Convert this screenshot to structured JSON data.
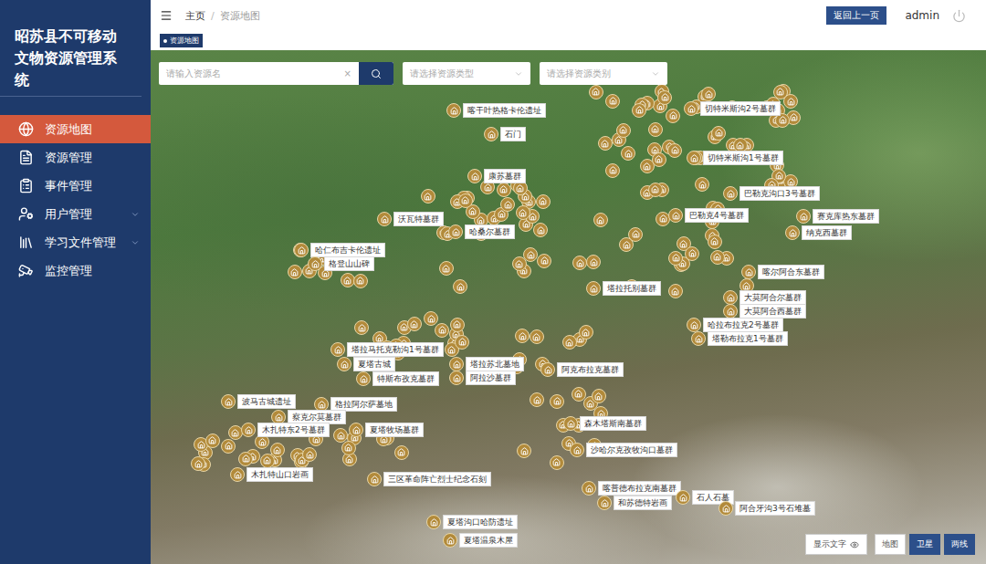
{
  "sidebar": {
    "title": "昭苏县不可移动文物资源管理系统",
    "items": [
      {
        "label": "资源地图",
        "selected": true,
        "expandable": false
      },
      {
        "label": "资源管理",
        "selected": false,
        "expandable": false
      },
      {
        "label": "事件管理",
        "selected": false,
        "expandable": false
      },
      {
        "label": "用户管理",
        "selected": false,
        "expandable": true
      },
      {
        "label": "学习文件管理",
        "selected": false,
        "expandable": true
      },
      {
        "label": "监控管理",
        "selected": false,
        "expandable": false
      }
    ]
  },
  "header": {
    "breadcrumb": [
      "主页",
      "资源地图"
    ],
    "separator": "/",
    "back_button": "返回上一页",
    "user": "admin"
  },
  "tags": [
    {
      "label": "资源地图",
      "selected": true
    }
  ],
  "search": {
    "placeholder": "请输入资源名",
    "clear": "×"
  },
  "filters": [
    {
      "placeholder": "请选择资源类型"
    },
    {
      "placeholder": "请选择资源类别"
    }
  ],
  "map": {
    "sites": [
      {
        "name": "喀干叶热格卡伦遗址"
      },
      {
        "name": "石门"
      },
      {
        "name": "切特米斯沟2号墓群"
      },
      {
        "name": "切特米斯沟1号墓群"
      },
      {
        "name": "康苏墓群"
      },
      {
        "name": "沃瓦特墓群"
      },
      {
        "name": "哈桑尔墓群"
      },
      {
        "name": "巴勒克沟口3号墓群"
      },
      {
        "name": "巴勒克4号墓群"
      },
      {
        "name": "赛克库热东墓群"
      },
      {
        "name": "纳克西墓群"
      },
      {
        "name": "哈仁布吉卡伦遗址"
      },
      {
        "name": "格登山山碑"
      },
      {
        "name": "喀尔阿合东墓群"
      },
      {
        "name": "塔拉托别墓群"
      },
      {
        "name": "大莫阿合尔墓群"
      },
      {
        "name": "大莫阿合西墓群"
      },
      {
        "name": "哈拉布拉克2号墓群"
      },
      {
        "name": "塔勒布拉克1号墓群"
      },
      {
        "name": "塔拉马托克勒沟1号墓群"
      },
      {
        "name": "夏塔古城"
      },
      {
        "name": "特斯布孜克墓群"
      },
      {
        "name": "塔拉苏北墓地"
      },
      {
        "name": "阿拉沙墓群"
      },
      {
        "name": "阿克布拉克墓群"
      },
      {
        "name": "波马古城遗址"
      },
      {
        "name": "格拉阿尔萨墓地"
      },
      {
        "name": "察克尔莫墓群"
      },
      {
        "name": "森木塔斯南墓群"
      },
      {
        "name": "夏塔牧场墓群"
      },
      {
        "name": "木扎特东2号墓群"
      },
      {
        "name": "沙哈尔克孜牧沟口墓群"
      },
      {
        "name": "木扎特山口岩画"
      },
      {
        "name": "三区革命阵亡烈士纪念石刻"
      },
      {
        "name": "喀普德布拉克南墓群"
      },
      {
        "name": "和苏德特岩画"
      },
      {
        "name": "石人石墓"
      },
      {
        "name": "阿合牙沟3号石堆墓"
      },
      {
        "name": "夏塔沟口哈防遗址"
      },
      {
        "name": "夏塔温泉木屋"
      }
    ]
  },
  "controls": {
    "show_text": "显示文字",
    "layers": [
      {
        "label": "地图",
        "selected": false
      },
      {
        "label": "卫星",
        "selected": true
      },
      {
        "label": "两线",
        "selected": true
      }
    ]
  }
}
